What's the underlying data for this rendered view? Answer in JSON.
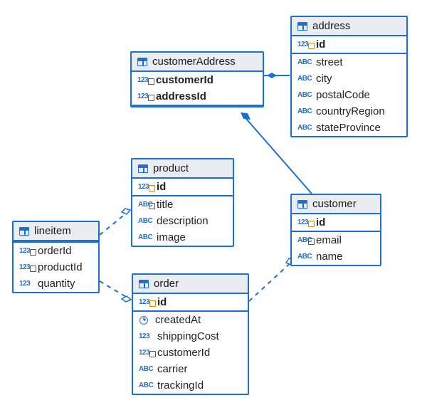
{
  "entities": {
    "address": {
      "name": "address",
      "pk": [
        {
          "type": "123",
          "key": "pk",
          "name": "id"
        }
      ],
      "fields": [
        {
          "type": "ABC",
          "name": "street"
        },
        {
          "type": "ABC",
          "name": "city"
        },
        {
          "type": "ABC",
          "name": "postalCode"
        },
        {
          "type": "ABC",
          "name": "countryRegion"
        },
        {
          "type": "ABC",
          "name": "stateProvince"
        }
      ]
    },
    "customerAddress": {
      "name": "customerAddress",
      "pk": [
        {
          "type": "123",
          "key": "fk",
          "name": "customerId"
        },
        {
          "type": "123",
          "key": "fk",
          "name": "addressId"
        }
      ],
      "fields": []
    },
    "product": {
      "name": "product",
      "pk": [
        {
          "type": "123",
          "key": "pk",
          "name": "id"
        }
      ],
      "fields": [
        {
          "type": "ABC",
          "key": "fk",
          "name": "title"
        },
        {
          "type": "ABC",
          "name": "description"
        },
        {
          "type": "ABC",
          "name": "image"
        }
      ]
    },
    "customer": {
      "name": "customer",
      "pk": [
        {
          "type": "123",
          "key": "pk",
          "name": "id"
        }
      ],
      "fields": [
        {
          "type": "ABC",
          "key": "fk",
          "name": "email"
        },
        {
          "type": "ABC",
          "name": "name"
        }
      ]
    },
    "lineitem": {
      "name": "lineitem",
      "pk": [],
      "fields": [
        {
          "type": "123",
          "key": "fk",
          "name": "orderId"
        },
        {
          "type": "123",
          "key": "fk",
          "name": "productId"
        },
        {
          "type": "123",
          "name": "quantity"
        }
      ]
    },
    "order": {
      "name": "order",
      "pk": [
        {
          "type": "123",
          "key": "pk",
          "name": "id"
        }
      ],
      "fields": [
        {
          "type": "clock",
          "name": "createdAt"
        },
        {
          "type": "123",
          "name": "shippingCost"
        },
        {
          "type": "123",
          "key": "fk",
          "name": "customerId"
        },
        {
          "type": "ABC",
          "name": "carrier"
        },
        {
          "type": "ABC",
          "name": "trackingId"
        }
      ]
    }
  },
  "connections": [
    {
      "from": "customerAddress",
      "to": "address",
      "style": "solid"
    },
    {
      "from": "customerAddress",
      "to": "customer",
      "style": "solid"
    },
    {
      "from": "order",
      "to": "customer",
      "style": "dashed"
    },
    {
      "from": "lineitem",
      "to": "product",
      "style": "dashed"
    },
    {
      "from": "lineitem",
      "to": "order",
      "style": "dashed"
    }
  ]
}
